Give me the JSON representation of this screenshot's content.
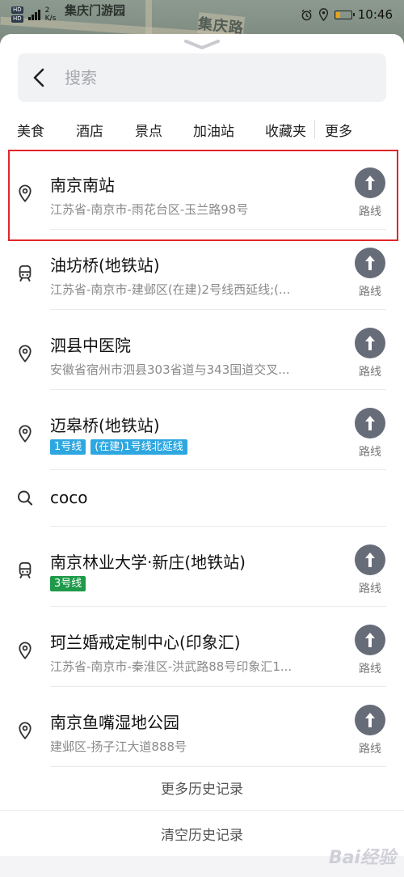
{
  "map": {
    "park_label": "集庆门游园",
    "road_label": "集庆路"
  },
  "status_bar": {
    "hd1": "HD",
    "hd2": "HD",
    "speed_value": "2",
    "speed_unit": "K/s",
    "time": "10:46"
  },
  "search": {
    "placeholder": "搜索",
    "value": ""
  },
  "categories": [
    "美食",
    "酒店",
    "景点",
    "加油站",
    "收藏夹",
    "更多"
  ],
  "route_label": "路线",
  "results": [
    {
      "type": "place",
      "icon": "location-pin-icon",
      "title": "南京南站",
      "address": "江苏省-南京市-雨花台区-玉兰路98号",
      "tags": []
    },
    {
      "type": "metro",
      "icon": "metro-icon",
      "title": "油坊桥(地铁站)",
      "address": "江苏省-南京市-建邺区(在建)2号线西延线;(...",
      "tags": []
    },
    {
      "type": "place",
      "icon": "location-pin-icon",
      "title": "泗县中医院",
      "address": "安徽省宿州市泗县303省道与343国道交叉...",
      "tags": []
    },
    {
      "type": "place",
      "icon": "location-pin-icon",
      "title": "迈皋桥(地铁站)",
      "address": "",
      "tags": [
        {
          "text": "1号线",
          "color": "#2ea7e0"
        },
        {
          "text": "(在建)1号线北延线",
          "color": "#2ea7e0"
        }
      ]
    },
    {
      "type": "query",
      "icon": "search-icon",
      "title": "coco",
      "address": "",
      "tags": []
    },
    {
      "type": "metro",
      "icon": "metro-icon",
      "title": "南京林业大学·新庄(地铁站)",
      "address": "",
      "tags": [
        {
          "text": "3号线",
          "color": "#1e9a4a"
        }
      ]
    },
    {
      "type": "place",
      "icon": "location-pin-icon",
      "title": "珂兰婚戒定制中心(印象汇)",
      "address": "江苏省-南京市-秦淮区-洪武路88号印象汇1...",
      "tags": []
    },
    {
      "type": "place",
      "icon": "location-pin-icon",
      "title": "南京鱼嘴湿地公园",
      "address": "建邺区-扬子江大道888号",
      "tags": []
    }
  ],
  "footer": {
    "more_history": "更多历史记录",
    "clear_history": "清空历史记录"
  },
  "watermark": "Bai经验",
  "colors": {
    "accent_highlight": "#e0262b",
    "route_button": "#676c79",
    "line1": "#2ea7e0",
    "line3": "#1e9a4a"
  }
}
